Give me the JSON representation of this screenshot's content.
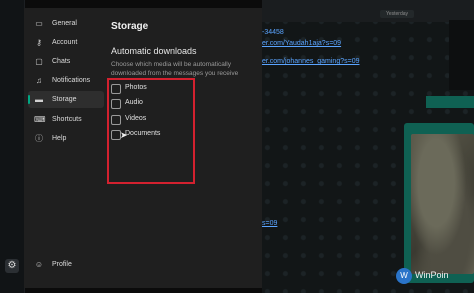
{
  "sidebar": {
    "items": [
      {
        "label": "General",
        "icon": "monitor-icon"
      },
      {
        "label": "Account",
        "icon": "key-icon"
      },
      {
        "label": "Chats",
        "icon": "chat-bubble-icon"
      },
      {
        "label": "Notifications",
        "icon": "bell-icon"
      },
      {
        "label": "Storage",
        "icon": "storage-drive-icon"
      },
      {
        "label": "Shortcuts",
        "icon": "keyboard-icon"
      },
      {
        "label": "Help",
        "icon": "info-icon"
      }
    ],
    "profile": {
      "label": "Profile",
      "icon": "person-icon"
    },
    "active": "Storage"
  },
  "panel": {
    "title": "Storage",
    "subtitle": "Automatic downloads",
    "description": "Choose which media will be automatically downloaded from the messages you receive",
    "options": [
      {
        "label": "Photos",
        "checked": false
      },
      {
        "label": "Audio",
        "checked": false
      },
      {
        "label": "Videos",
        "checked": false
      },
      {
        "label": "Documents",
        "checked": false
      }
    ]
  },
  "chat": {
    "date_chip": "Yesterday",
    "messages": [
      {
        "text": "-34458"
      },
      {
        "text": "er.com/Yaudah1aja?s=09"
      },
      {
        "text": "er.com/johannes_gaming?s=09"
      },
      {
        "text": "s=09"
      }
    ]
  },
  "watermark": {
    "text": "WinPoin"
  },
  "colors": {
    "accent": "#00a884",
    "highlight": "#d3212f",
    "link": "#5aa4ff"
  }
}
